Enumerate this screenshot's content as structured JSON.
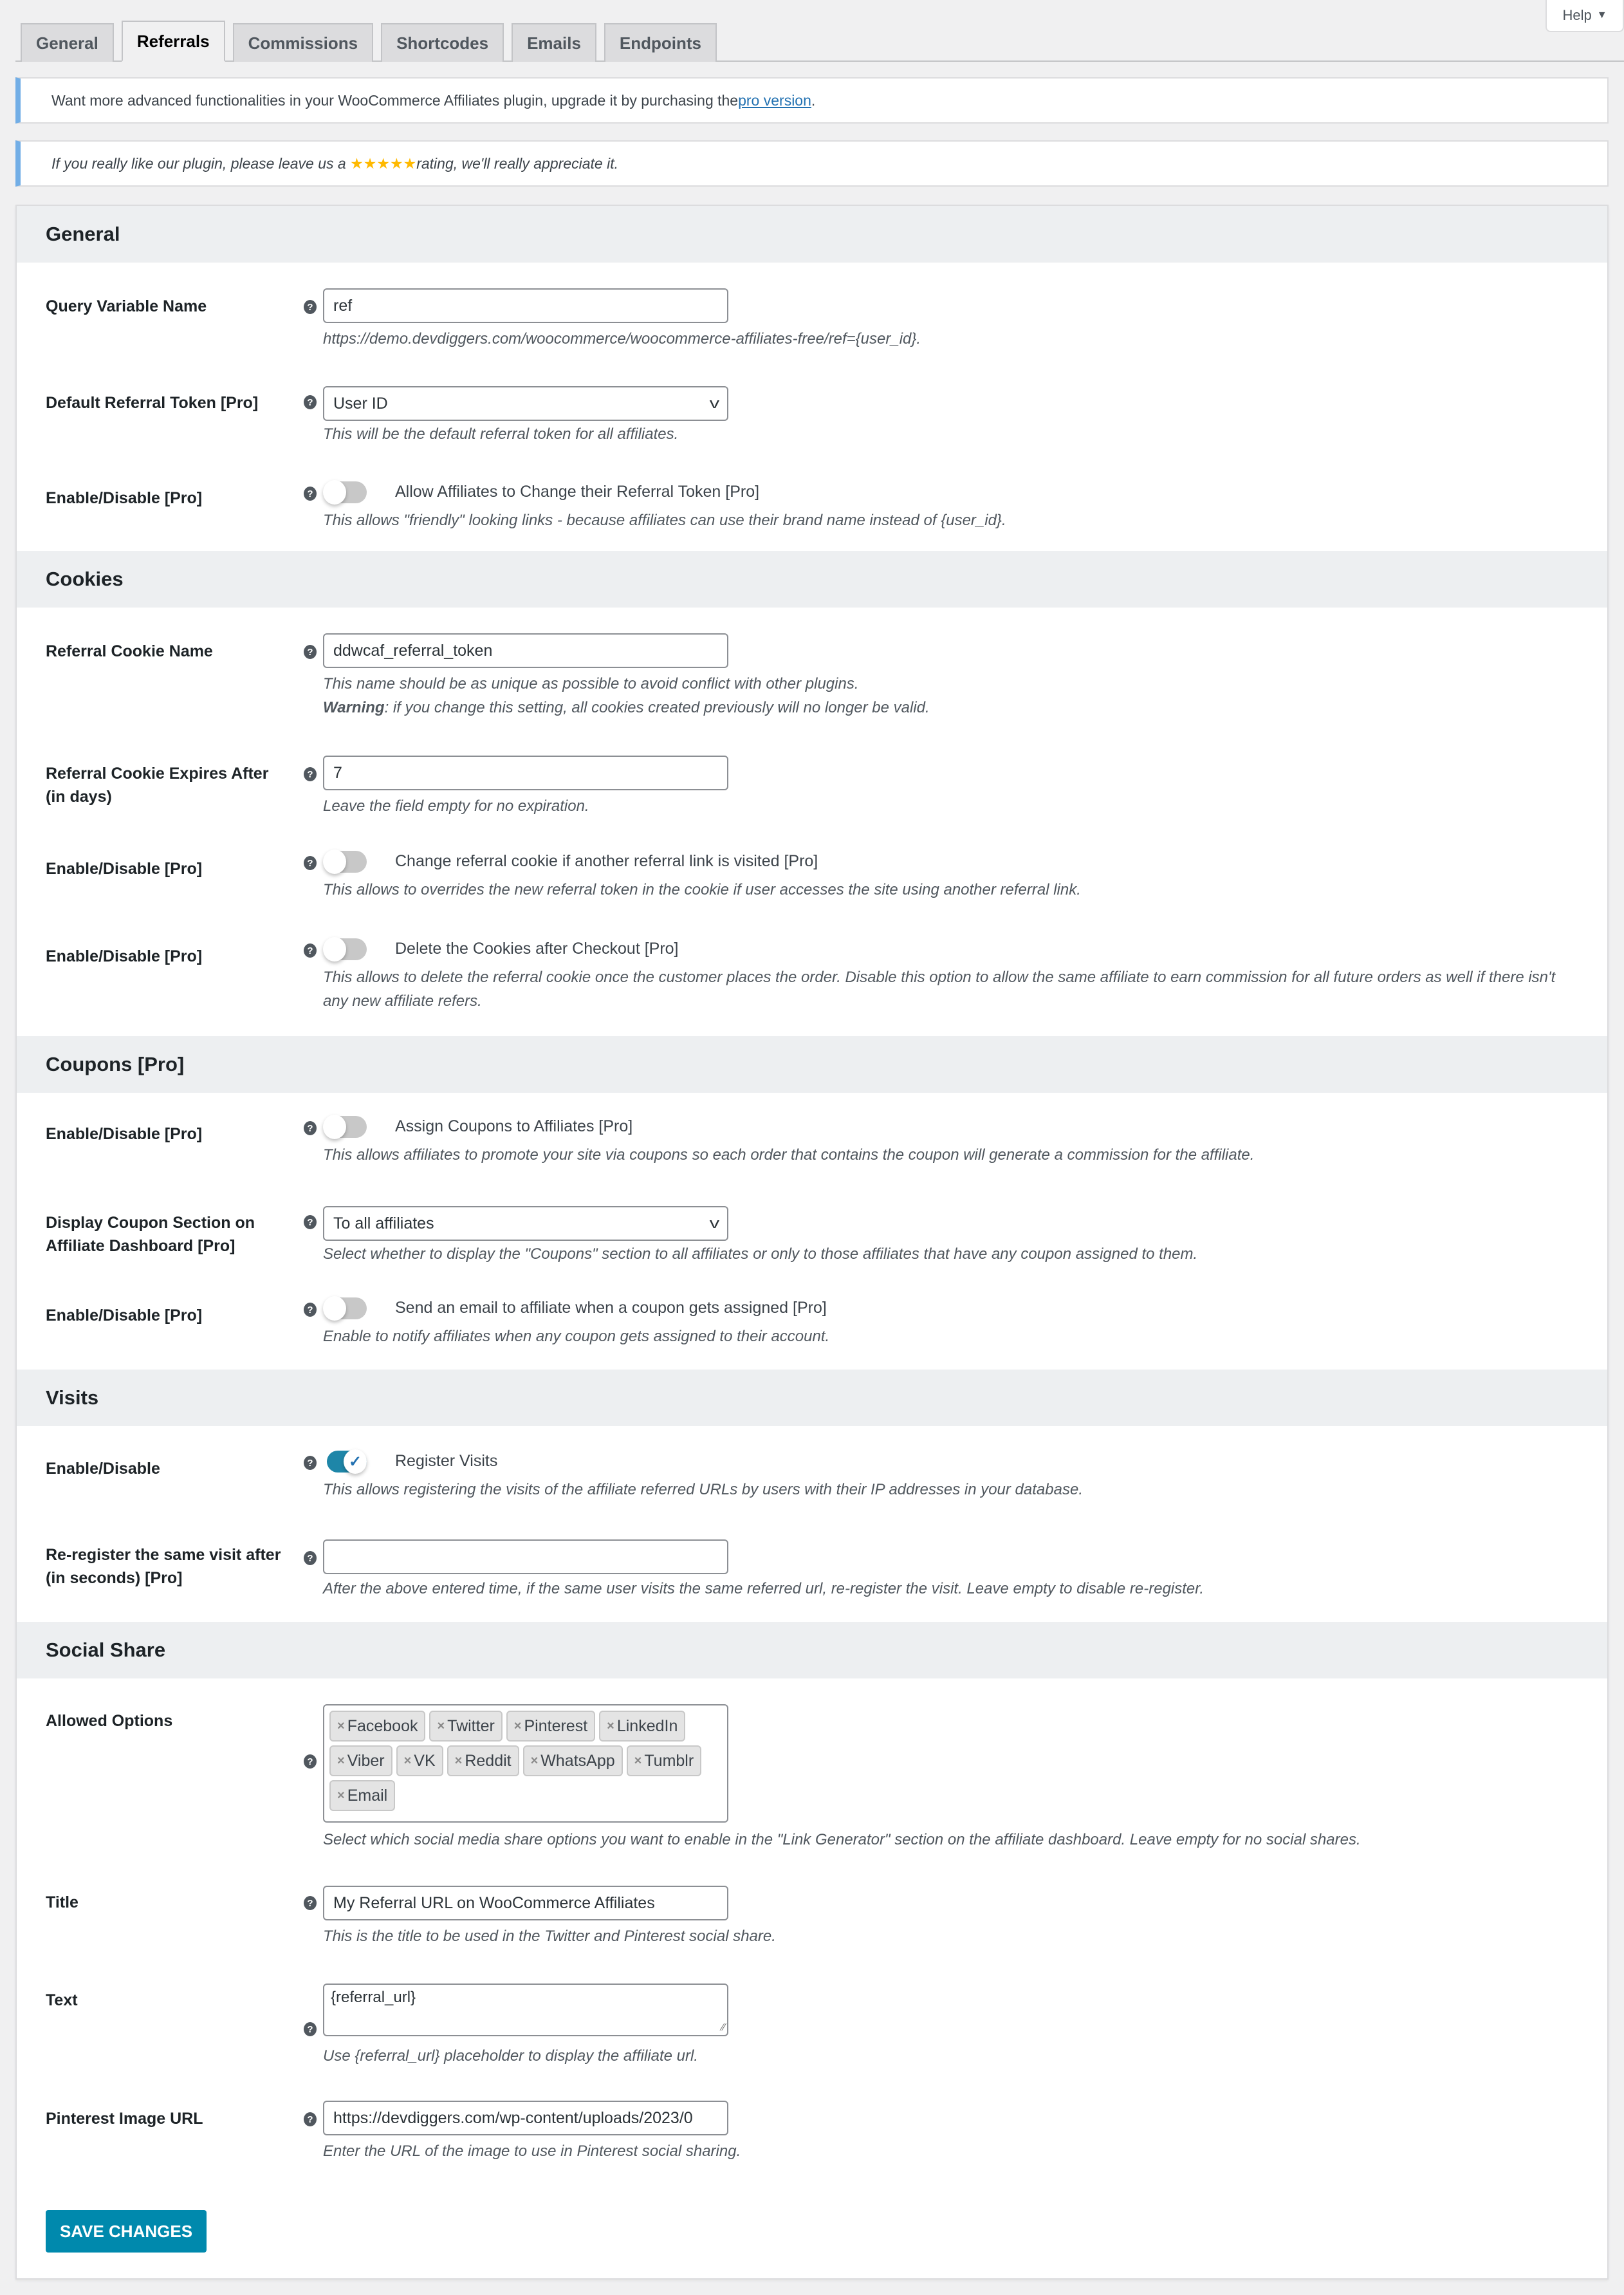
{
  "help_tab": {
    "label": "Help",
    "arrow": "▼"
  },
  "tabs": [
    {
      "label": "General",
      "active": false
    },
    {
      "label": "Referrals",
      "active": true
    },
    {
      "label": "Commissions",
      "active": false
    },
    {
      "label": "Shortcodes",
      "active": false
    },
    {
      "label": "Emails",
      "active": false
    },
    {
      "label": "Endpoints",
      "active": false
    }
  ],
  "notices": {
    "upgrade": {
      "text": "Want more advanced functionalities in your WooCommerce Affiliates plugin, upgrade it by purchasing the ",
      "link": "pro version",
      "suffix": "."
    },
    "rating": {
      "prefix": "If you really like our plugin, please leave us a ",
      "stars": "★★★★★",
      "suffix": " rating, we'll really appreciate it."
    }
  },
  "sections": {
    "general": {
      "title": "General",
      "query_var": {
        "label": "Query Variable Name",
        "value": "ref",
        "desc": "https://demo.devdiggers.com/woocommerce/woocommerce-affiliates-free/ref={user_id}."
      },
      "default_token": {
        "label": "Default Referral Token [Pro]",
        "value": "User ID",
        "desc": "This will be the default referral token for all affiliates."
      },
      "change_token": {
        "label": "Enable/Disable [Pro]",
        "toggle_label": "Allow Affiliates to Change their Referral Token [Pro]",
        "enabled": false,
        "desc": "This allows \"friendly\" looking links - because affiliates can use their brand name instead of {user_id}."
      }
    },
    "cookies": {
      "title": "Cookies",
      "cookie_name": {
        "label": "Referral Cookie Name",
        "value": "ddwcaf_referral_token",
        "desc": "This name should be as unique as possible to avoid conflict with other plugins.",
        "warning_label": "Warning",
        "warning_text": ": if you change this setting, all cookies created previously will no longer be valid."
      },
      "cookie_expires": {
        "label": "Referral Cookie Expires After (in days)",
        "value": "7",
        "desc": "Leave the field empty for no expiration."
      },
      "change_cookie": {
        "label": "Enable/Disable [Pro]",
        "toggle_label": "Change referral cookie if another referral link is visited [Pro]",
        "enabled": false,
        "desc": "This allows to overrides the new referral token in the cookie if user accesses the site using another referral link."
      },
      "delete_cookies": {
        "label": "Enable/Disable [Pro]",
        "toggle_label": "Delete the Cookies after Checkout [Pro]",
        "enabled": false,
        "desc": "This allows to delete the referral cookie once the customer places the order. Disable this option to allow the same affiliate to earn commission for all future orders as well if there isn't any new affiliate refers."
      }
    },
    "coupons": {
      "title": "Coupons [Pro]",
      "assign_coupons": {
        "label": "Enable/Disable [Pro]",
        "toggle_label": "Assign Coupons to Affiliates [Pro]",
        "enabled": false,
        "desc": "This allows affiliates to promote your site via coupons so each order that contains the coupon will generate a commission for the affiliate."
      },
      "display_coupon": {
        "label": "Display Coupon Section on Affiliate Dashboard [Pro]",
        "value": "To all affiliates",
        "desc": "Select whether to display the \"Coupons\" section to all affiliates or only to those affiliates that have any coupon assigned to them."
      },
      "email_coupon": {
        "label": "Enable/Disable [Pro]",
        "toggle_label": "Send an email to affiliate when a coupon gets assigned [Pro]",
        "enabled": false,
        "desc": "Enable to notify affiliates when any coupon gets assigned to their account."
      }
    },
    "visits": {
      "title": "Visits",
      "register_visits": {
        "label": "Enable/Disable",
        "toggle_label": "Register Visits",
        "enabled": true,
        "desc": "This allows registering the visits of the affiliate referred URLs by users with their IP addresses in your database."
      },
      "reregister": {
        "label": "Re-register the same visit after (in seconds) [Pro]",
        "value": "",
        "desc": "After the above entered time, if the same user visits the same referred url, re-register the visit. Leave empty to disable re-register."
      }
    },
    "social": {
      "title": "Social Share",
      "allowed_options": {
        "label": "Allowed Options",
        "tags": [
          "Facebook",
          "Twitter",
          "Pinterest",
          "LinkedIn",
          "Viber",
          "VK",
          "Reddit",
          "WhatsApp",
          "Tumblr",
          "Email"
        ],
        "remove_glyph": "×",
        "desc": "Select which social media share options you want to enable in the \"Link Generator\" section on the affiliate dashboard. Leave empty for no social shares."
      },
      "title_field": {
        "label": "Title",
        "value": "My Referral URL on WooCommerce Affiliates",
        "desc": "This is the title to be used in the Twitter and Pinterest social share."
      },
      "text_field": {
        "label": "Text",
        "value": "{referral_url}",
        "desc": "Use {referral_url} placeholder to display the affiliate url."
      },
      "pinterest_image": {
        "label": "Pinterest Image URL",
        "value": "https://devdiggers.com/wp-content/uploads/2023/0",
        "desc": "Enter the URL of the image to use in Pinterest social sharing."
      }
    }
  },
  "save_button": {
    "label": "Save Changes"
  },
  "icons": {
    "help": "?",
    "chevron": "v",
    "check": "✓",
    "resize_grip": "⁄⁄"
  },
  "colors": {
    "accent": "#0089ad",
    "toggle_on": "#1e86a8",
    "notice_border": "#72aee6",
    "stars": "#ffb900",
    "link": "#2271b1"
  }
}
